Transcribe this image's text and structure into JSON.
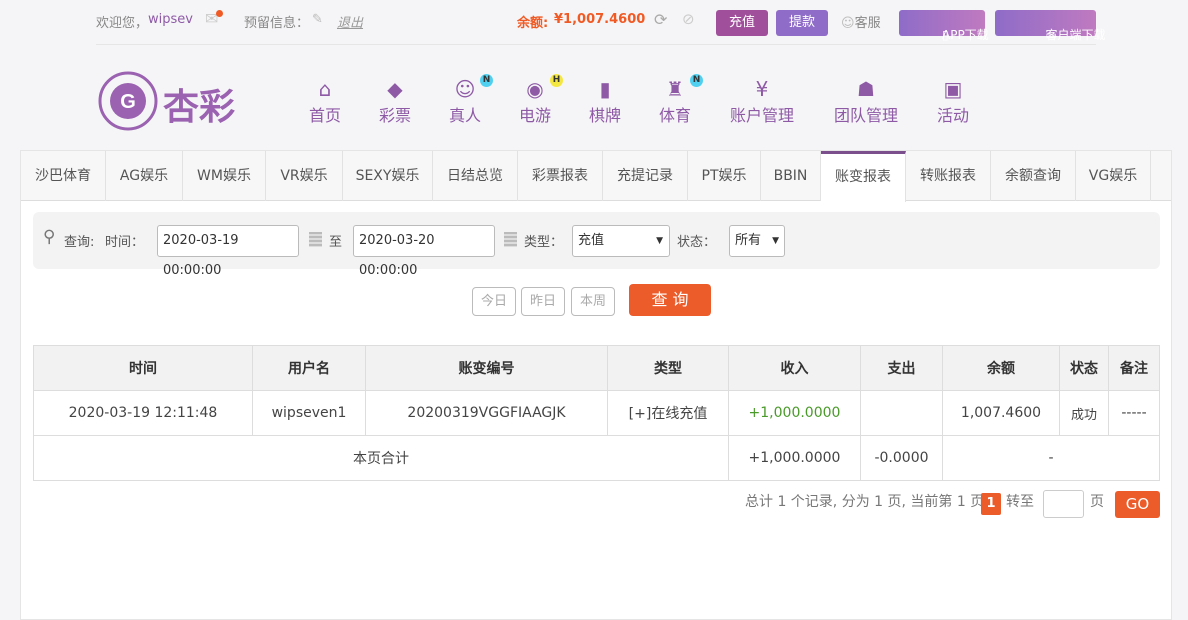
{
  "top": {
    "welcome": "欢迎您，",
    "username": "wipsev",
    "reserved_info": "预留信息：",
    "logout": "退出",
    "balance_label": "余额:",
    "balance": "¥1,007.4600",
    "deposit": "充值",
    "withdraw": "提款",
    "service": "客服",
    "app_download": "APP下载",
    "client_download": "客户端下载"
  },
  "logo": {
    "text": "杏彩"
  },
  "nav": [
    {
      "label": "首页",
      "icon": "⌂"
    },
    {
      "label": "彩票",
      "icon": "◆"
    },
    {
      "label": "真人",
      "icon": "☺",
      "badge": "N"
    },
    {
      "label": "电游",
      "icon": "◉",
      "badge": "H"
    },
    {
      "label": "棋牌",
      "icon": "▮"
    },
    {
      "label": "体育",
      "icon": "♜",
      "badge": "N"
    },
    {
      "label": "账户管理",
      "icon": "¥"
    },
    {
      "label": "团队管理",
      "icon": "☗"
    },
    {
      "label": "活动",
      "icon": "▣"
    }
  ],
  "tabs": [
    "沙巴体育",
    "AG娱乐",
    "WM娱乐",
    "VR娱乐",
    "SEXY娱乐",
    "日结总览",
    "彩票报表",
    "充提记录",
    "PT娱乐",
    "BBIN",
    "账变报表",
    "转账报表",
    "余额查询",
    "VG娱乐"
  ],
  "query": {
    "label": "查询:",
    "time_label": "时间：",
    "start": "2020-03-19 00:00:00",
    "to": "至",
    "end": "2020-03-20 00:00:00",
    "type_label": "类型：",
    "type_value": "充值",
    "status_label": "状态：",
    "status_value": "所有",
    "today": "今日",
    "yesterday": "昨日",
    "this_week": "本周",
    "search": "查 询"
  },
  "table": {
    "headers": [
      "时间",
      "用户名",
      "账变编号",
      "类型",
      "收入",
      "支出",
      "余额",
      "状态",
      "备注"
    ],
    "row": [
      "2020-03-19 12:11:48",
      "wipseven1",
      "20200319VGGFIAAGJK",
      "[+]在线充值",
      "+1,000.0000",
      "",
      "1,007.4600",
      "成功",
      "-----"
    ],
    "total_label": "本页合计",
    "total_income": "+1,000.0000",
    "total_expense": "-0.0000",
    "total_balance": "-"
  },
  "pagination": {
    "summary": "总计 1 个记录, 分为 1 页, 当前第 1 页",
    "current": "1",
    "goto": "转至",
    "page": "页",
    "go": "GO"
  }
}
